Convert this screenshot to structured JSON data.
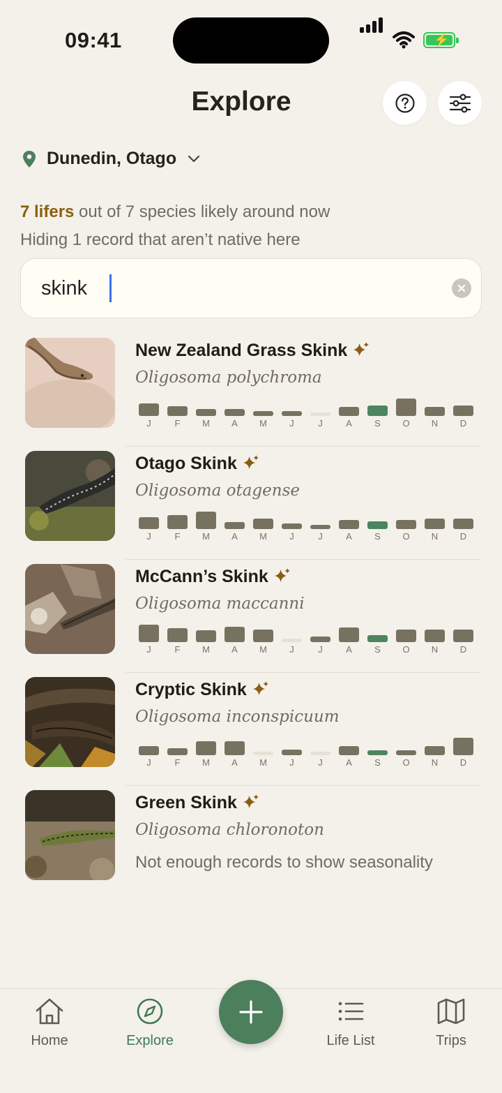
{
  "status": {
    "time": "09:41"
  },
  "header": {
    "title": "Explore",
    "help_icon": "question-circle-icon",
    "filter_icon": "sliders-icon"
  },
  "location": {
    "label": "Dunedin, Otago"
  },
  "summary": {
    "lifers": "7 lifers",
    "rest": " out of 7 species likely around now",
    "hidden": "Hiding 1 record that aren’t native here"
  },
  "search": {
    "value": "skink"
  },
  "months": [
    "J",
    "F",
    "M",
    "A",
    "M",
    "J",
    "J",
    "A",
    "S",
    "O",
    "N",
    "D"
  ],
  "colors": {
    "accent": "#4c7f5c",
    "lifer": "#8c5f0f",
    "bar": "#777260",
    "bar_current": "#4c8560"
  },
  "species": [
    {
      "name": "New Zealand Grass Skink",
      "scientific": "Oligosoma polychroma",
      "seasonality": [
        0.65,
        0.5,
        0.35,
        0.35,
        0.25,
        0.25,
        0.15,
        0.45,
        0.55,
        0.9,
        0.45,
        0.55
      ]
    },
    {
      "name": "Otago Skink",
      "scientific": "Oligosoma otagense",
      "seasonality": [
        0.6,
        0.7,
        0.9,
        0.35,
        0.55,
        0.3,
        0.2,
        0.45,
        0.4,
        0.45,
        0.55,
        0.55
      ]
    },
    {
      "name": "McCann’s Skink",
      "scientific": "Oligosoma maccanni",
      "seasonality": [
        0.9,
        0.7,
        0.6,
        0.8,
        0.65,
        0.15,
        0.3,
        0.75,
        0.35,
        0.65,
        0.65,
        0.65
      ]
    },
    {
      "name": "Cryptic Skink",
      "scientific": "Oligosoma inconspicuum",
      "seasonality": [
        0.45,
        0.35,
        0.7,
        0.7,
        0.15,
        0.3,
        0.15,
        0.45,
        0.25,
        0.25,
        0.45,
        0.9
      ]
    },
    {
      "name": "Green Skink",
      "scientific": "Oligosoma chloronoton",
      "note": "Not enough records to show seasonality"
    }
  ],
  "current_month_index": 8,
  "tabs": {
    "home": "Home",
    "explore": "Explore",
    "lifelist": "Life List",
    "trips": "Trips"
  }
}
